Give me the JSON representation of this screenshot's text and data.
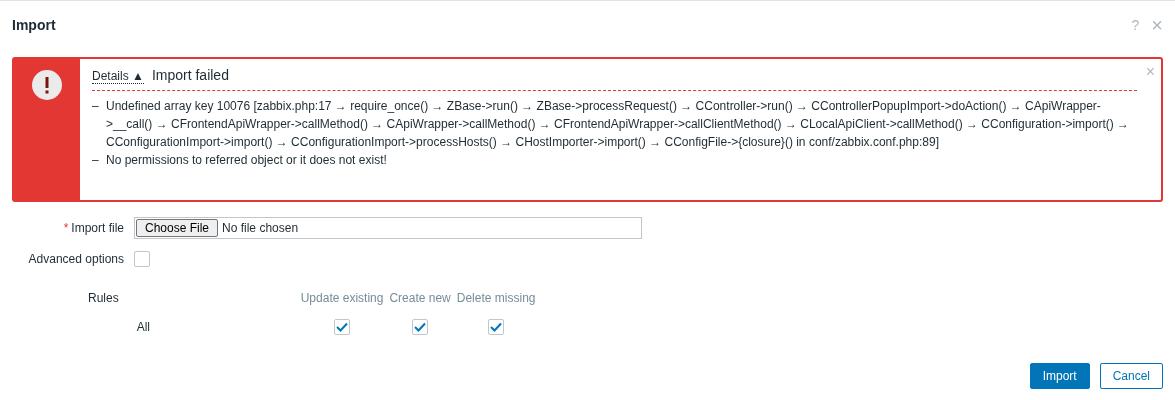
{
  "window": {
    "title": "Import",
    "help": "?",
    "close": "×"
  },
  "message": {
    "toggle": "Details",
    "toggle_arrow": "▲",
    "expanded": true,
    "title": "Import failed",
    "close": "×",
    "bullet": "–",
    "items": [
      "Undefined array key 10076 [zabbix.php:17 → require_once() → ZBase->run() → ZBase->processRequest() → CController->run() → CControllerPopupImport->doAction() → CApiWrapper->__call() → CFrontendApiWrapper->callMethod() → CApiWrapper->callMethod() → CFrontendApiWrapper->callClientMethod() → CLocalApiClient->callMethod() → CConfiguration->import() → CConfigurationImport->import() → CConfigurationImport->processHosts() → CHostImporter->import() → CConfigFile->{closure}() in conf/zabbix.conf.php:89]",
      "No permissions to referred object or it does not exist!"
    ]
  },
  "form": {
    "import_file": {
      "label": "Import file",
      "required_mark": "*",
      "button": "Choose File",
      "value": "No file chosen"
    },
    "advanced_options": {
      "label": "Advanced options",
      "checked": false
    },
    "rules": {
      "label": "Rules",
      "columns": [
        "Update existing",
        "Create new",
        "Delete missing"
      ],
      "rows": [
        {
          "label": "All",
          "checks": [
            {
              "checked": true
            },
            {
              "checked": true
            },
            {
              "checked": true
            }
          ]
        }
      ]
    }
  },
  "buttons": [
    {
      "label": "Import",
      "kind": "primary"
    },
    {
      "label": "Cancel",
      "kind": "secondary"
    }
  ]
}
